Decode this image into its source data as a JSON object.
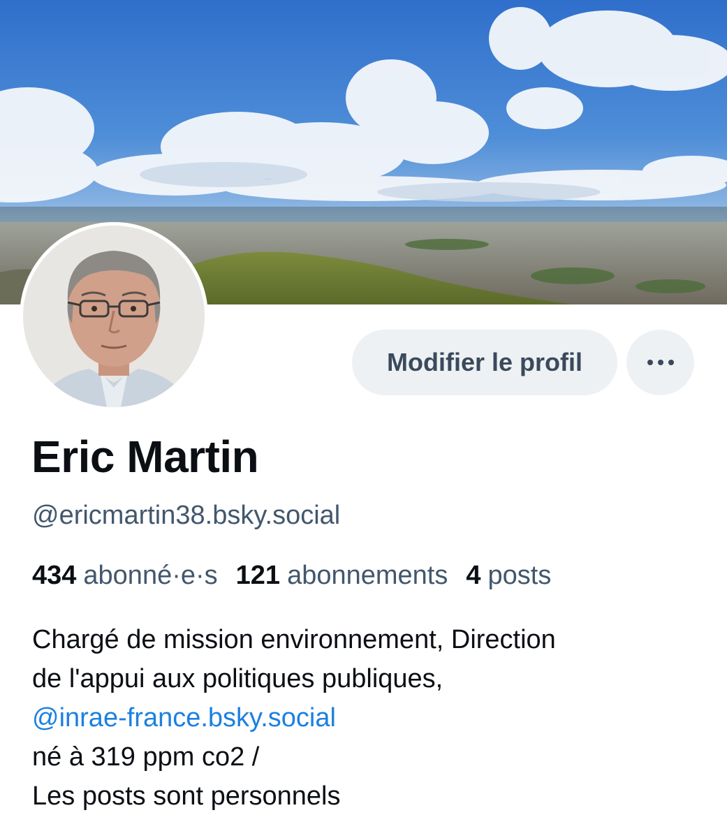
{
  "profile": {
    "display_name": "Eric Martin",
    "handle": "@ericmartin38.bsky.social",
    "edit_button_label": "Modifier le profil",
    "more_icon": "ellipsis-horizontal-icon",
    "avatar_image": "profile-photo",
    "banner_image": "landscape-banner-photo"
  },
  "stats": {
    "followers": {
      "count": "434",
      "label": "abonné·e·s"
    },
    "following": {
      "count": "121",
      "label": "abonnements"
    },
    "posts": {
      "count": "4",
      "label": "posts"
    }
  },
  "bio": {
    "line1": "Chargé de mission environnement, Direction",
    "line2": "de l'appui aux politiques publiques,",
    "mention": "@inrae-france.bsky.social",
    "line4": "né à 319 ppm co2 /",
    "line5": "Les posts sont personnels"
  },
  "colors": {
    "link": "#1c80e0",
    "muted_text": "#42576c",
    "button_bg": "#eef1f4",
    "button_text": "#3a4a5c"
  }
}
